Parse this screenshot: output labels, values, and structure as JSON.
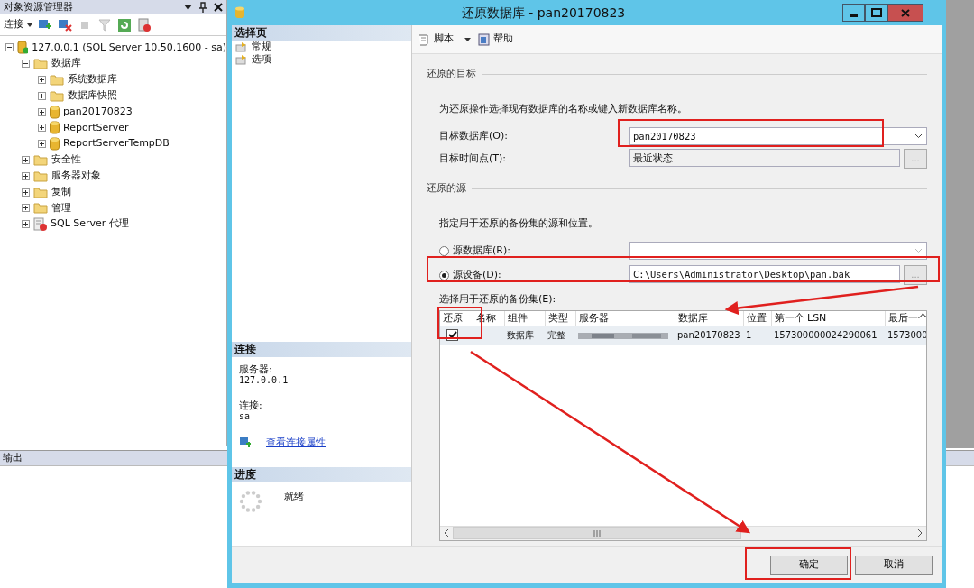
{
  "explorer": {
    "title": "对象资源管理器",
    "connect": "连接",
    "tree": [
      {
        "label": "127.0.0.1 (SQL Server 10.50.1600 - sa)",
        "kind": "server",
        "expanded": true,
        "children": [
          {
            "label": "数据库",
            "kind": "folder",
            "expanded": true,
            "children": [
              {
                "label": "系统数据库",
                "kind": "folder",
                "expanded": false
              },
              {
                "label": "数据库快照",
                "kind": "folder",
                "expanded": false
              },
              {
                "label": "pan20170823",
                "kind": "database",
                "expanded": false
              },
              {
                "label": "ReportServer",
                "kind": "database",
                "expanded": false
              },
              {
                "label": "ReportServerTempDB",
                "kind": "database",
                "expanded": false
              }
            ]
          },
          {
            "label": "安全性",
            "kind": "folder",
            "expanded": false
          },
          {
            "label": "服务器对象",
            "kind": "folder",
            "expanded": false
          },
          {
            "label": "复制",
            "kind": "folder",
            "expanded": false
          },
          {
            "label": "管理",
            "kind": "folder",
            "expanded": false
          },
          {
            "label": "SQL Server 代理",
            "kind": "agent",
            "expanded": false
          }
        ]
      }
    ]
  },
  "output_panel": {
    "title": "输出"
  },
  "dialog": {
    "title": "还原数据库 - pan20170823",
    "select_page": {
      "title": "选择页",
      "items": [
        "常规",
        "选项"
      ]
    },
    "connection": {
      "title": "连接",
      "server_label": "服务器:",
      "server": "127.0.0.1",
      "login_label": "连接:",
      "login": "sa",
      "link": "查看连接属性"
    },
    "progress": {
      "title": "进度",
      "status": "就绪"
    },
    "toolbar": [
      {
        "label": "脚本",
        "kind": "script",
        "dropdown": true
      },
      {
        "label": "帮助",
        "kind": "help",
        "dropdown": false
      }
    ],
    "destination": {
      "title": "还原的目标",
      "hint": "为还原操作选择现有数据库的名称或键入新数据库名称。",
      "fields": [
        {
          "label": "目标数据库(O):",
          "value": "pan20170823",
          "kind": "combo",
          "disabled": false
        },
        {
          "label": "目标时间点(T):",
          "value": "最近状态",
          "kind": "browse",
          "disabled": true,
          "button": "..."
        }
      ]
    },
    "source": {
      "title": "还原的源",
      "hint": "指定用于还原的备份集的源和位置。",
      "options": [
        {
          "label": "源数据库(R):",
          "kind": "combo",
          "selected": false
        },
        {
          "label": "源设备(D):",
          "kind": "browse",
          "selected": true,
          "value": "C:\\Users\\Administrator\\Desktop\\pan.bak",
          "button": "..."
        }
      ]
    },
    "backup_sets": {
      "label": "选择用于还原的备份集(E):",
      "columns": [
        "还原",
        "名称",
        "组件",
        "类型",
        "服务器",
        "数据库",
        "位置",
        "第一个 LSN",
        "最后一个"
      ],
      "rows": [
        {
          "cells": [
            {
              "kind": "checkbox",
              "checked": true
            },
            "",
            "数据库",
            "完整",
            {
              "kind": "redacted"
            },
            "pan20170823",
            "1",
            "157300000024290061",
            "1573000"
          ]
        }
      ]
    },
    "buttons": [
      "确定",
      "取消"
    ]
  }
}
